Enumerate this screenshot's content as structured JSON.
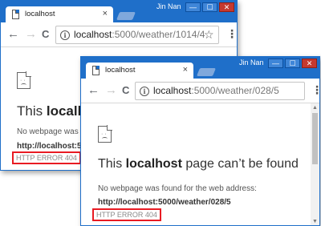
{
  "back_window": {
    "tab_title": "localhost",
    "tab_close": "×",
    "user": "Jin Nan",
    "controls": {
      "minimize": "—",
      "maximize": "☐",
      "close": "✕"
    },
    "url_host": "localhost",
    "url_path": ":5000/weather/1014/4",
    "heading_prefix": "This ",
    "heading_bold": "localho",
    "message": "No webpage was f",
    "address": "http://localhost:5",
    "error": "HTTP ERROR 404"
  },
  "front_window": {
    "tab_title": "localhost",
    "tab_close": "×",
    "user": "Jin Nan",
    "controls": {
      "minimize": "—",
      "maximize": "☐",
      "close": "✕"
    },
    "url_host": "localhost",
    "url_path": ":5000/weather/028/5",
    "heading_prefix": "This ",
    "heading_bold": "localhost",
    "heading_suffix": " page can’t be found",
    "message": "No webpage was found for the web address:",
    "address": "http://localhost:5000/weather/028/5",
    "error": "HTTP ERROR 404"
  },
  "icons": {
    "back": "←",
    "forward": "→",
    "reload": "C",
    "info": "i",
    "star": "☆",
    "menu": "⋮"
  },
  "colors": {
    "chrome_blue": "#1f6fc9",
    "error_highlight": "#e81b23"
  }
}
